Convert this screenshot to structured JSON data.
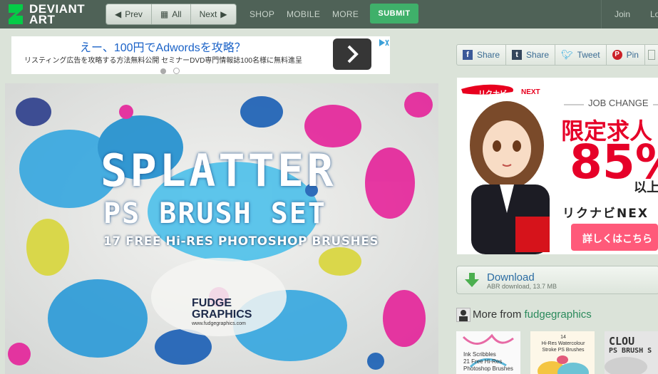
{
  "header": {
    "logo_line1": "DEVIANT",
    "logo_line2": "ART",
    "prev_label": "Prev",
    "all_label": "All",
    "next_label": "Next",
    "nav": [
      "SHOP",
      "MOBILE",
      "MORE"
    ],
    "submit_label": "SUBMIT",
    "join_label": "Join",
    "login_label": "Lo"
  },
  "ad_banner": {
    "headline": "えー、100円でAdwordsを攻略？",
    "subtext": "リスティング広告を攻略する方法無料公開 セミナーDVD専門情報誌100名様に無料進呈"
  },
  "artwork": {
    "title_line1": "SPLATTER",
    "title_line2": "PS BRUSH SET",
    "title_line3": "17 FREE Hi-RES PHOTOSHOP BRUSHES",
    "brand1": "FUDGE",
    "brand2": "GRAPHICS",
    "url": "www.fudgegraphics.com"
  },
  "share": {
    "facebook": "Share",
    "tumblr": "Share",
    "twitter": "Tweet",
    "pinterest": "Pin"
  },
  "side_ad": {
    "brand": "リクナビ",
    "brand_suffix": "NEXT",
    "job_change": "JOB CHANGE",
    "headline": "限定求人",
    "percent": "85%",
    "above": "以上",
    "brand_kana": "リクナビNEX",
    "cta": "詳しくはこちら"
  },
  "download": {
    "label": "Download",
    "info": "ABR download, 13.7 MB"
  },
  "more_from": {
    "prefix": "More from",
    "user": "fudgegraphics"
  },
  "thumbnails": [
    {
      "lines": [
        "Ink Scribbles",
        "21 Free Hi-Res",
        "Photoshop Brushes"
      ]
    },
    {
      "lines": [
        "14",
        "Hi-Res Watercolour",
        "Stroke PS Brushes"
      ]
    },
    {
      "lines": [
        "CLOU",
        "PS BRUSH S"
      ]
    }
  ],
  "colors": {
    "topbar": "#4f6257",
    "submit": "#3fb06a",
    "link_blue": "#2b6ca3",
    "link_green": "#2b8a5c",
    "background": "#dbe3d9"
  }
}
